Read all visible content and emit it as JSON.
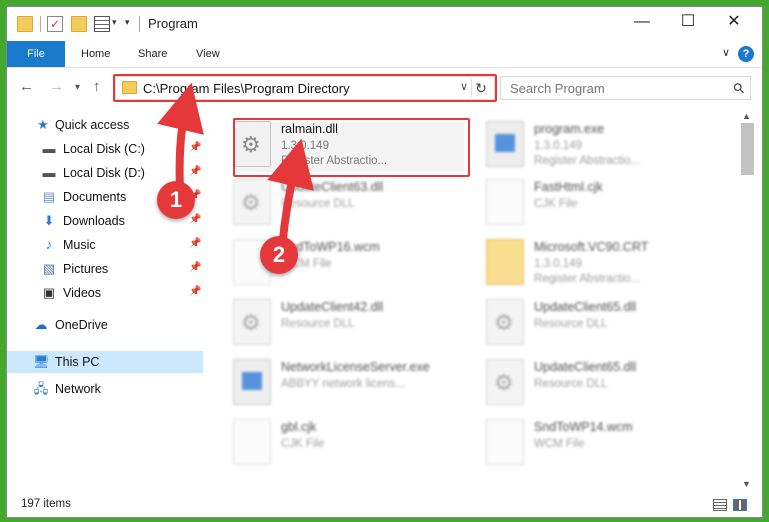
{
  "window": {
    "title": "Program",
    "controls": {
      "minimize": "—",
      "maximize": "☐",
      "close": "✕"
    }
  },
  "quick_access_toolbar": {
    "icons": [
      "folder-icon",
      "properties-check-icon",
      "new-folder-icon",
      "properties-icon",
      "customize-chevron-icon"
    ]
  },
  "ribbon": {
    "tabs": [
      "File",
      "Home",
      "Share",
      "View"
    ],
    "active_tab": "File",
    "accent": "#1979ca"
  },
  "nav": {
    "address": "C:\\Program Files\\Program Directory",
    "search_placeholder": "Search Program"
  },
  "sidebar": {
    "items": [
      {
        "label": "Quick access",
        "icon": "star-icon",
        "pinned": false
      },
      {
        "label": "Local Disk (C:)",
        "icon": "drive-icon",
        "pinned": true
      },
      {
        "label": "Local Disk (D:)",
        "icon": "drive-icon",
        "pinned": true
      },
      {
        "label": "Documents",
        "icon": "documents-icon",
        "pinned": true
      },
      {
        "label": "Downloads",
        "icon": "downloads-icon",
        "pinned": true
      },
      {
        "label": "Music",
        "icon": "music-icon",
        "pinned": true
      },
      {
        "label": "Pictures",
        "icon": "pictures-icon",
        "pinned": true
      },
      {
        "label": "Videos",
        "icon": "videos-icon",
        "pinned": true
      },
      {
        "label": "OneDrive",
        "icon": "cloud-icon",
        "pinned": false
      },
      {
        "label": "This PC",
        "icon": "computer-icon",
        "pinned": false,
        "selected": true
      },
      {
        "label": "Network",
        "icon": "network-icon",
        "pinned": false
      }
    ]
  },
  "files": [
    {
      "name": "ralmain.dll",
      "line1": "1.3.0.149",
      "line2": "Register Abstractio...",
      "type": "dll",
      "highlighted": true
    },
    {
      "name": "program.exe",
      "line1": "1.3.0.149",
      "line2": "Register Abstractio...",
      "type": "exe"
    },
    {
      "name": "UpdateClient63.dll",
      "line1": "Resource DLL",
      "line2": "",
      "type": "dll"
    },
    {
      "name": "FastHtml.cjk",
      "line1": "CJK File",
      "line2": "",
      "type": "doc"
    },
    {
      "name": "SndToWP16.wcm",
      "line1": "WCM File",
      "line2": "",
      "type": "doc"
    },
    {
      "name": "Microsoft.VC90.CRT",
      "line1": "1.3.0.149",
      "line2": "Register Abstractio...",
      "type": "crt"
    },
    {
      "name": "UpdateClient42.dll",
      "line1": "Resource DLL",
      "line2": "",
      "type": "dll"
    },
    {
      "name": "UpdateClient65.dll",
      "line1": "Resource DLL",
      "line2": "",
      "type": "dll"
    },
    {
      "name": "NetworkLicenseServer.exe",
      "line1": "ABBYY network licens...",
      "line2": "",
      "type": "exe"
    },
    {
      "name": "UpdateClient65.dll",
      "line1": "Resource DLL",
      "line2": "",
      "type": "dll"
    },
    {
      "name": "gbl.cjk",
      "line1": "CJK File",
      "line2": "",
      "type": "doc"
    },
    {
      "name": "SndToWP14.wcm",
      "line1": "WCM File",
      "line2": "",
      "type": "doc"
    }
  ],
  "status": {
    "item_count": "197 items"
  },
  "callouts": {
    "one": "1",
    "two": "2",
    "color": "#e5383b"
  }
}
